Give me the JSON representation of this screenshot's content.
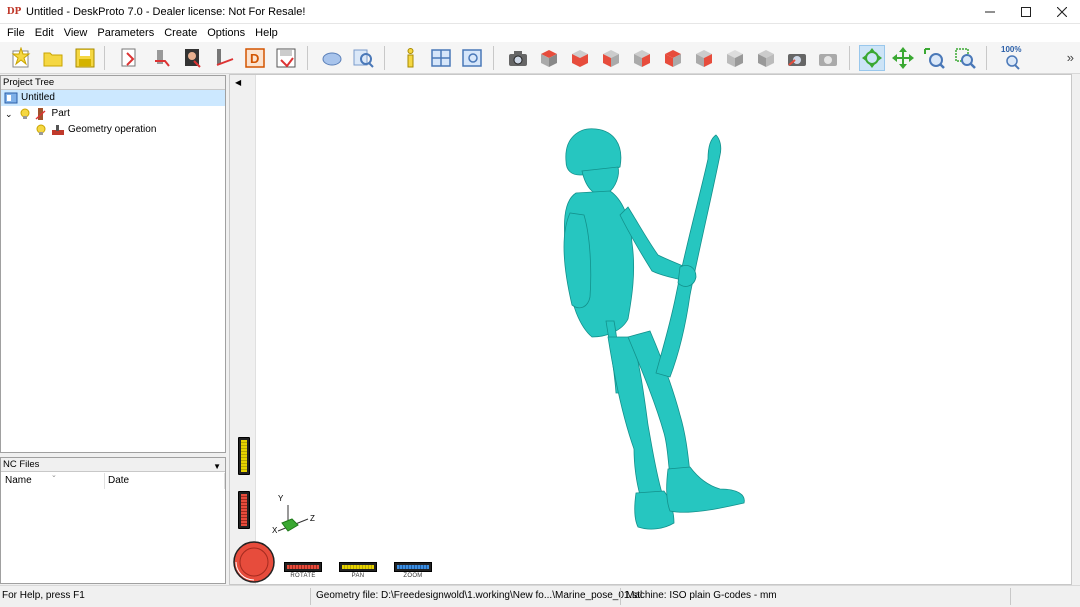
{
  "window": {
    "title": "Untitled - DeskProto 7.0 - Dealer license: Not For Resale!",
    "icon_text": "DP"
  },
  "menu": [
    "File",
    "Edit",
    "View",
    "Parameters",
    "Create",
    "Options",
    "Help"
  ],
  "toolbar": {
    "zoom_label": "100%",
    "more": "»"
  },
  "project_tree": {
    "header": "Project Tree",
    "items": [
      {
        "label": "Untitled"
      },
      {
        "label": "Part"
      },
      {
        "label": "Geometry operation"
      }
    ]
  },
  "nc_files": {
    "header": "NC Files",
    "columns": [
      "Name",
      "Date"
    ]
  },
  "viewport": {
    "axes": {
      "x": "X",
      "y": "Y",
      "z": "Z"
    },
    "controls": [
      "ROTATE",
      "PAN",
      "ZOOM"
    ]
  },
  "status": {
    "help": "For Help, press F1",
    "geometry": "Geometry file: D:\\Freedesignwold\\1.working\\New fo...\\Marine_pose_01.stl",
    "machine": "Machine: ISO plain G-codes - mm"
  },
  "colors": {
    "model": "#26c6c0",
    "accent": "#cce8ff"
  }
}
